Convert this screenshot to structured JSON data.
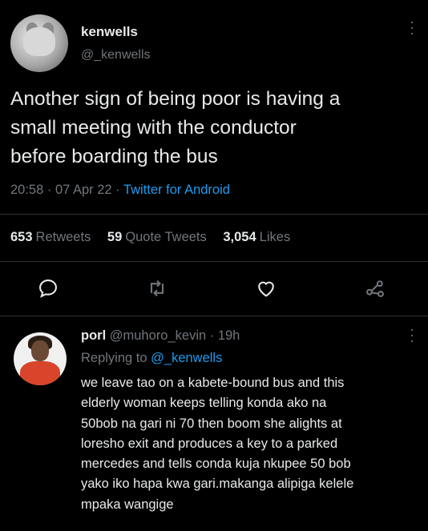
{
  "tweet": {
    "name": "kenwells",
    "handle": "@_kenwells",
    "text_lines": [
      "Another sign of being poor is having a",
      "small meeting with the conductor",
      "before boarding the bus"
    ],
    "timestamp": "20:58 · 07 Apr 22 · ",
    "source": "Twitter for Android",
    "stats": {
      "retweets_count": "653",
      "retweets_label": "Retweets",
      "quotes_count": "59",
      "quotes_label": "Quote Tweets",
      "likes_count": "3,054",
      "likes_label": "Likes"
    },
    "icons": {
      "reply": "reply-icon",
      "retweet": "retweet-icon",
      "like": "heart-icon",
      "share": "share-icon",
      "more": "more-icon"
    }
  },
  "reply": {
    "name": "porl",
    "handle": "@muhoro_kevin",
    "time": " · 19h",
    "replying_prefix": "Replying to ",
    "replying_to": "@_kenwells",
    "text_lines": [
      "we leave tao on a kabete-bound bus and this",
      "elderly woman keeps telling konda ako na",
      "50bob na gari ni 70 then boom she alights at",
      "loresho exit and produces a key to a parked",
      "mercedes and tells conda kuja nkupee 50 bob",
      "yako iko hapa kwa gari.makanga alipiga kelele",
      "mpaka wangige"
    ]
  },
  "colors": {
    "background": "#000000",
    "text": "#e7e9ea",
    "muted": "#71767b",
    "link": "#1d9bf0",
    "divider": "#2f3336"
  }
}
